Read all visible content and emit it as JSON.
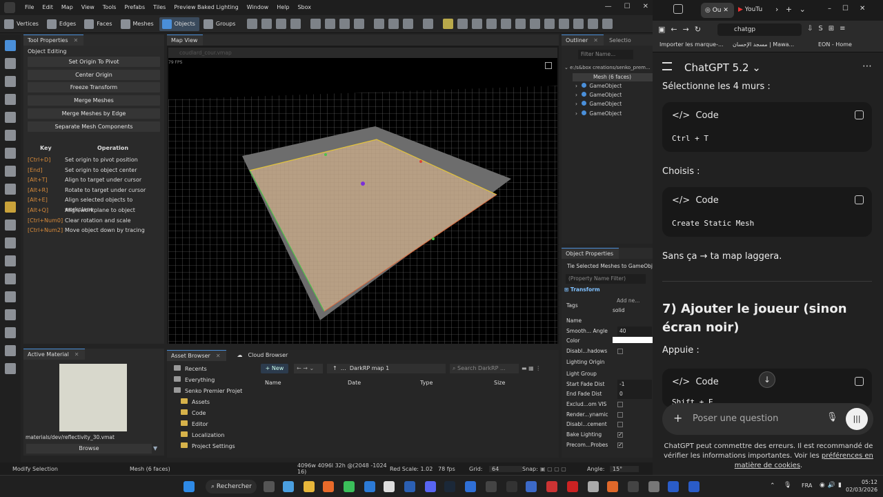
{
  "menu": {
    "items": [
      "File",
      "Edit",
      "Map",
      "View",
      "Tools",
      "Prefabs",
      "Tiles",
      "Preview Baked Lighting",
      "Window",
      "Help",
      "Sbox"
    ]
  },
  "toolbar": {
    "modes": [
      {
        "label": "Vertices",
        "active": false
      },
      {
        "label": "Edges",
        "active": false
      },
      {
        "label": "Faces",
        "active": false
      },
      {
        "label": "Meshes",
        "active": false
      },
      {
        "label": "Objects",
        "active": true
      },
      {
        "label": "Groups",
        "active": false
      }
    ]
  },
  "tool_properties": {
    "title": "Tool Properties",
    "section": "Object Editing",
    "buttons": [
      "Set Origin To Pivot",
      "Center Origin",
      "Freeze Transform",
      "Merge Meshes",
      "Merge Meshes by Edge",
      "Separate Mesh Components"
    ],
    "key_header": "Key",
    "op_header": "Operation",
    "shortcuts": [
      {
        "key": "[Ctrl+D]",
        "op": "Set origin to pivot position"
      },
      {
        "key": "[End]",
        "op": "Set origin to object center"
      },
      {
        "key": "[Alt+T]",
        "op": "Align to target under cursor"
      },
      {
        "key": "[Alt+R]",
        "op": "Rotate to target under cursor"
      },
      {
        "key": "[Alt+E]",
        "op": "Align selected objects to workplane"
      },
      {
        "key": "[Alt+Q]",
        "op": "Align workplane to object"
      },
      {
        "key": "[Ctrl+Num0]",
        "op": "Clear rotation and scale"
      },
      {
        "key": "[Ctrl+Num2]",
        "op": "Move object down by tracing"
      }
    ]
  },
  "active_material": {
    "title": "Active Material",
    "path": "materials/dev/reflectivity_30.vmat",
    "browse": "Browse"
  },
  "map_view": {
    "title": "Map View",
    "file_tab": "coudlard_cour.vmap",
    "fps_overlay": "79 FPS"
  },
  "asset_browser": {
    "tab1": "Asset Browser",
    "tab2": "Cloud Browser",
    "new_label": "New",
    "path": "DarkRP map 1",
    "search_placeholder": "Search DarkRP ...",
    "columns": [
      "Name",
      "Date",
      "Type",
      "Size"
    ],
    "tree": [
      {
        "label": "Recents",
        "indent": 0
      },
      {
        "label": "Everything",
        "indent": 0
      },
      {
        "label": "Senko Premier Projet",
        "indent": 0
      },
      {
        "label": "Assets",
        "indent": 1
      },
      {
        "label": "Code",
        "indent": 1
      },
      {
        "label": "Editor",
        "indent": 1
      },
      {
        "label": "Localization",
        "indent": 1
      },
      {
        "label": "Project Settings",
        "indent": 1
      }
    ]
  },
  "outliner": {
    "title": "Outliner",
    "tab2": "Selectio",
    "filter_placeholder": "Filter Name...",
    "root": "e:/s&box creations/senko_prem...",
    "selected": "Mesh (6 faces)",
    "items": [
      "GameObject",
      "GameObject",
      "GameObject",
      "GameObject"
    ]
  },
  "object_properties": {
    "title": "Object Properties",
    "subtitle": "Tie Selected Meshes to GameObject",
    "filter_placeholder": "(Property Name Filter)",
    "section": "Transform",
    "add_new": "Add ne...",
    "tag_value": "solid",
    "rows": [
      {
        "label": "Tags",
        "value": ""
      },
      {
        "label": "Name",
        "value": ""
      },
      {
        "label": "Smooth... Angle",
        "value": "40"
      },
      {
        "label": "Color",
        "value": ""
      },
      {
        "label": "Disabl...hadows",
        "value": "check-off"
      },
      {
        "label": "Lighting Origin",
        "value": ""
      },
      {
        "label": "Light Group",
        "value": ""
      },
      {
        "label": "Start Fade Dist",
        "value": "-1"
      },
      {
        "label": "End Fade Dist",
        "value": "0"
      },
      {
        "label": "Exclud...om VIS",
        "value": "check-off"
      },
      {
        "label": "Render...ynamic",
        "value": "check-off"
      },
      {
        "label": "Disabl...cement",
        "value": "check-off"
      },
      {
        "label": "Bake Lighting",
        "value": "check-on"
      },
      {
        "label": "Precom...Probes",
        "value": "check-on"
      }
    ]
  },
  "status": {
    "mode": "Modify Selection",
    "selection": "Mesh (6 faces)",
    "coords": "4096w 4096l 32h @(2048 -1024 16)",
    "render_scale": "Red Scale: 1.02",
    "fps": "78 fps",
    "grid_label": "Grid:",
    "grid_value": "64",
    "snap_label": "Snap:",
    "angle_label": "Angle:",
    "angle_value": "15°"
  },
  "browser": {
    "tabs": [
      "Ou",
      "YouTu"
    ],
    "url": "chatgp",
    "bookmarks": [
      "Importer les marque-...",
      "مسجد الإحسان | Mawa...",
      "EON - Home"
    ]
  },
  "chat": {
    "model": "ChatGPT 5.2",
    "line1": "Sélectionne les 4 murs :",
    "code_label": "Code",
    "code1": "Ctrl + T",
    "line2": "Choisis :",
    "code2": "Create Static Mesh",
    "line3": "Sans ça → ta map laggera.",
    "heading": "7) Ajouter le joueur (sinon écran noir)",
    "line4": "Appuie :",
    "code3": "Shift + E",
    "input_placeholder": "Poser une question",
    "disclaimer": "ChatGPT peut commettre des erreurs. Il est recommandé de vérifier les informations importantes. Voir les",
    "disclaimer_link": "préférences en matière de cookies",
    "disclaimer_end": "."
  },
  "taskbar": {
    "search": "Rechercher",
    "lang": "FRA",
    "time": "05:12",
    "date": "02/03/2026"
  }
}
